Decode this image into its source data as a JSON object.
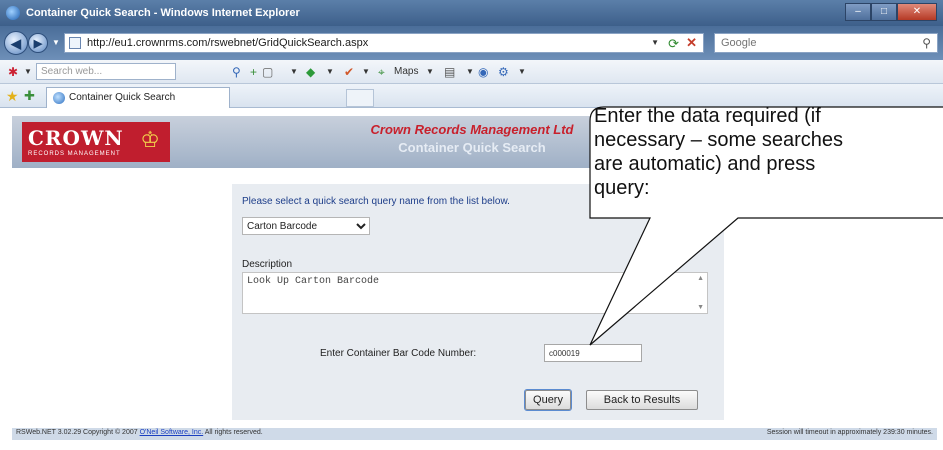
{
  "window": {
    "title": "Container Quick Search - Windows Internet Explorer",
    "controls": [
      "–",
      "□",
      "✕"
    ]
  },
  "address_bar": {
    "url": "http://eu1.crownrms.com/rswebnet/GridQuickSearch.aspx",
    "search_placeholder": "Google"
  },
  "toolbar": {
    "search_web_placeholder": "Search web...",
    "maps_label": "Maps"
  },
  "tabs": {
    "active_label": "Container Quick Search"
  },
  "brand": {
    "logo_word": "CROWN",
    "logo_tagline": "RECORDS MANAGEMENT",
    "colors": {
      "logo_red": "#c01e2e",
      "title_red": "#c8202c",
      "link_blue": "#1a3fc0"
    }
  },
  "page": {
    "app_title": "Crown Records Management Ltd",
    "app_subtitle": "Container Quick Search",
    "prompt": "Please select a quick search query name from the list below.",
    "selected_query": "Carton Barcode",
    "description_label": "Description",
    "description_text": "Look Up Carton Barcode",
    "barcode_label": "Enter Container Bar Code Number:",
    "barcode_value": "c000019",
    "query_button": "Query",
    "back_button": "Back to Results"
  },
  "footer": {
    "copyright_prefix": "RSWeb.NET 3.02.29 Copyright © 2007",
    "company_link": "O'Neil Software, Inc.",
    "rights": "All rights reserved.",
    "session": "Session will timeout in approximately 239:30 minutes."
  },
  "callout": {
    "lines": [
      "Enter the data required (if",
      "necessary – some searches",
      "are automatic) and press",
      "query:"
    ]
  }
}
